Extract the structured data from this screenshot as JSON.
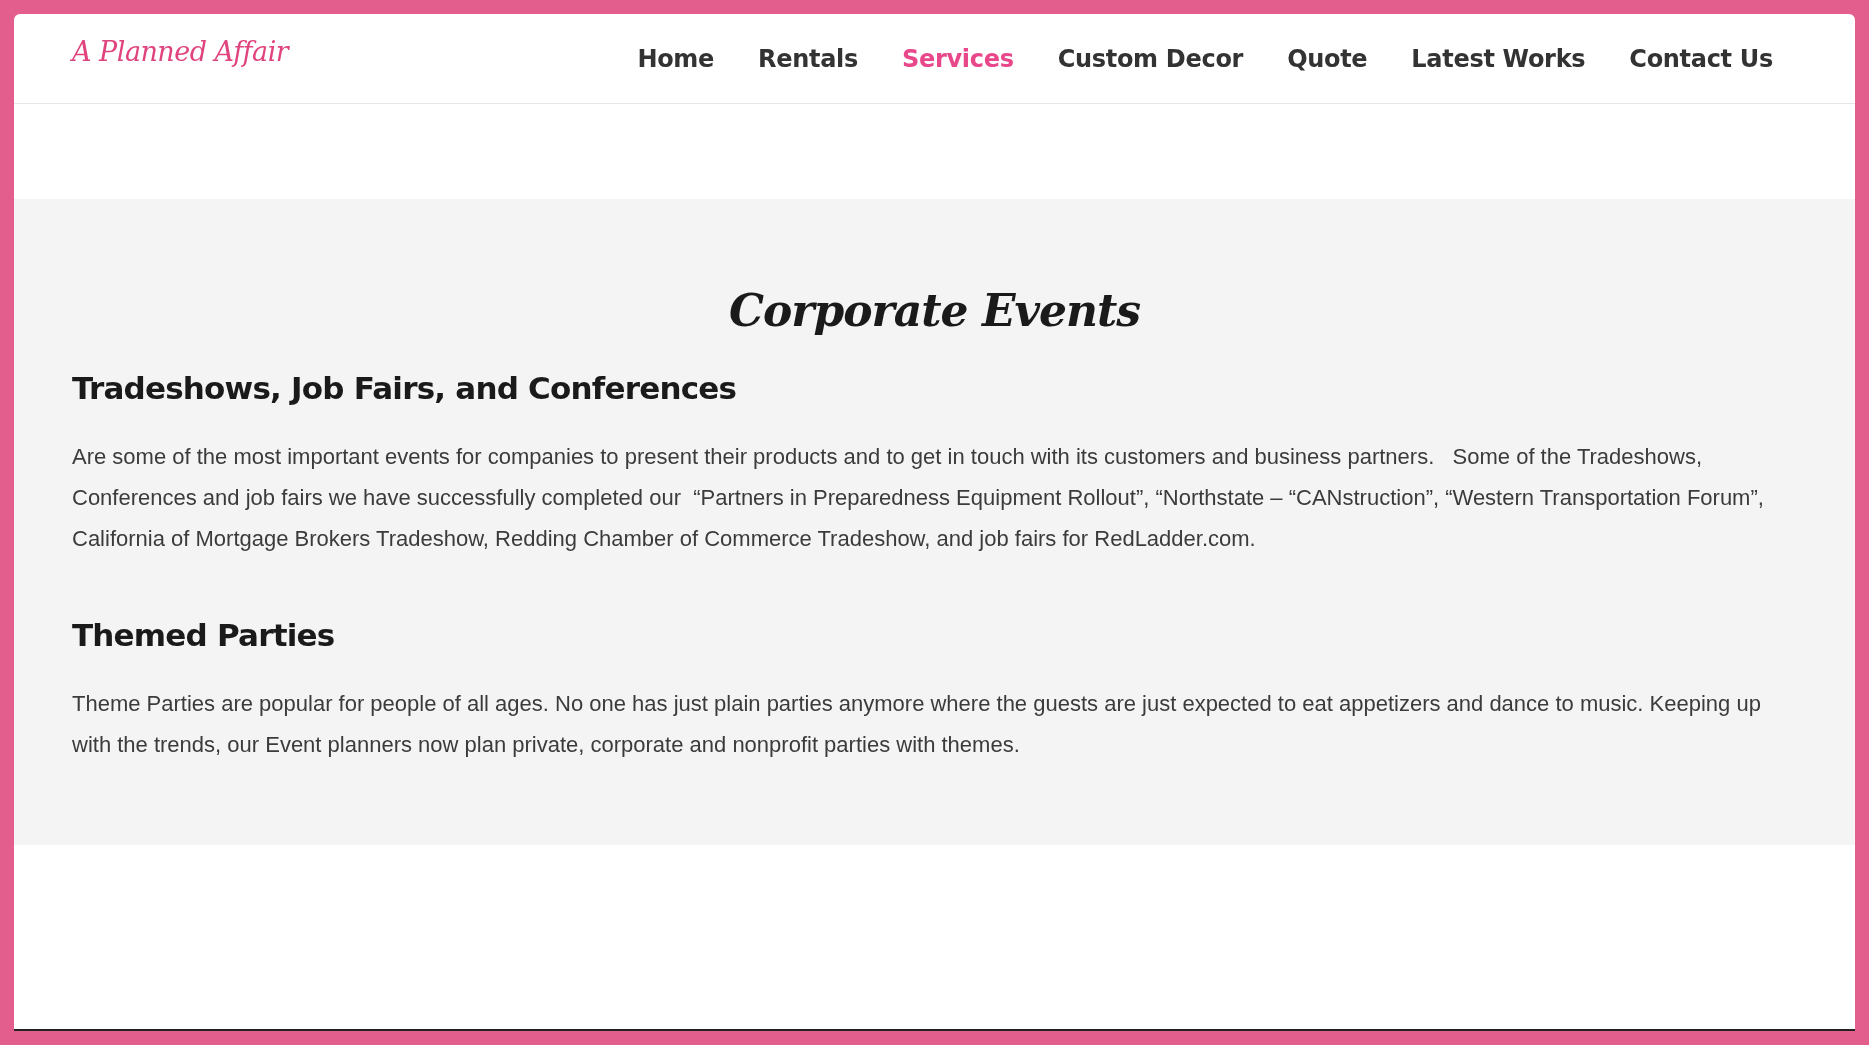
{
  "header": {
    "logo": "A Planned Affair",
    "nav": [
      {
        "label": "Home",
        "selected": false
      },
      {
        "label": "Rentals",
        "selected": false
      },
      {
        "label": "Services",
        "selected": true
      },
      {
        "label": "Custom Decor",
        "selected": false
      },
      {
        "label": "Quote",
        "selected": false
      },
      {
        "label": "Latest Works",
        "selected": false
      },
      {
        "label": "Contact Us",
        "selected": false
      }
    ]
  },
  "content": {
    "title": "Corporate Events",
    "sections": [
      {
        "heading": "Tradeshows, Job Fairs, and Conferences",
        "text": "Are some of the most important events for companies to present their products and to get in touch with its customers and business partners.   Some of the Tradeshows, Conferences and job fairs we have successfully completed our  “Partners in Preparedness Equipment Rollout”, “Northstate – “CANstruction”, “Western Transportation Forum”, California of Mortgage Brokers Tradeshow, Redding Chamber of Commerce Tradeshow, and job fairs for RedLadder.com."
      },
      {
        "heading": "Themed Parties",
        "text": "Theme Parties are popular for people of all ages. No one has just plain parties anymore where the guests are just expected to eat appetizers and dance to music. Keeping up with the trends, our Event planners now plan private, corporate and nonprofit parties with themes."
      }
    ]
  }
}
